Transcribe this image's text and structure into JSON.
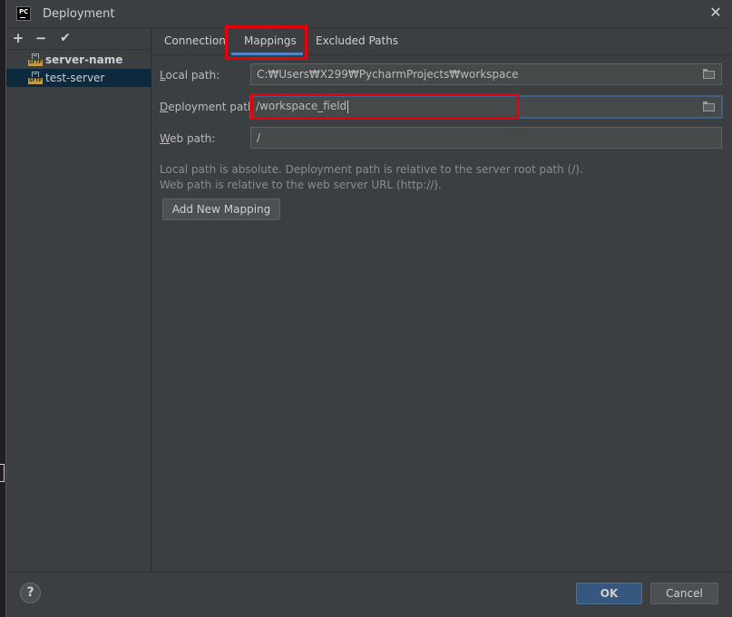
{
  "window": {
    "title": "Deployment",
    "app_icon": "PC",
    "close_glyph": "✕"
  },
  "sidebar": {
    "toolbar": {
      "add": "+",
      "remove": "−",
      "check": "✔"
    },
    "items": [
      {
        "label": "server-name",
        "bold": true,
        "icon": "sftp-icon",
        "icon_text": "SFTP"
      },
      {
        "label": "test-server",
        "bold": false,
        "icon": "sftp-icon",
        "icon_text": "SFTP",
        "selected": true
      }
    ]
  },
  "tabs": [
    {
      "label": "Connection"
    },
    {
      "label": "Mappings",
      "active": true
    },
    {
      "label": "Excluded Paths"
    }
  ],
  "form": {
    "local_path": {
      "label_mn": "L",
      "label_rest": "ocal path:",
      "value": "C:₩Users₩X299₩PycharmProjects₩workspace"
    },
    "deployment_path": {
      "label_mn": "D",
      "label_rest": "eployment path:",
      "value": "/workspace_field"
    },
    "web_path": {
      "label_mn": "W",
      "label_rest": "eb path:",
      "value": "/"
    },
    "help_line1": "Local path is absolute. Deployment path is relative to the server root path (/).",
    "help_line2": "Web path is relative to the web server URL (http://).",
    "add_mapping": "Add New Mapping"
  },
  "footer": {
    "help": "?",
    "ok": "OK",
    "cancel": "Cancel"
  },
  "colors": {
    "accent": "#4a88c7",
    "highlight": "#e8000b",
    "selection": "#0d293e",
    "primary_button": "#365880"
  }
}
